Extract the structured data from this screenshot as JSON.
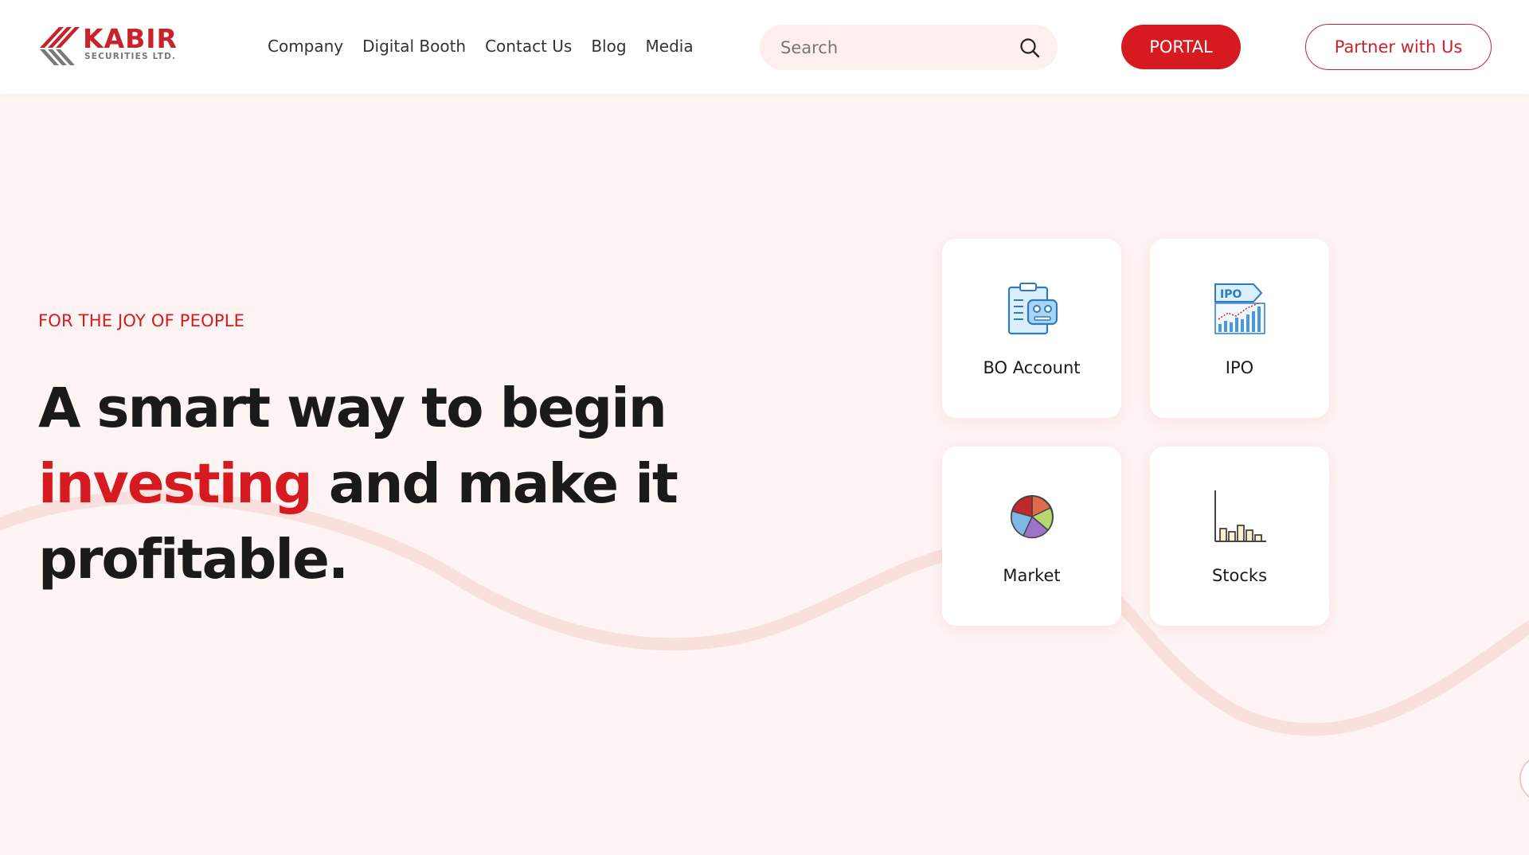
{
  "brand": {
    "name": "KABIR",
    "sub": "SECURITIES LTD.",
    "primary_color": "#d71920"
  },
  "nav": {
    "items": [
      {
        "label": "Company"
      },
      {
        "label": "Digital Booth"
      },
      {
        "label": "Contact Us"
      },
      {
        "label": "Blog"
      },
      {
        "label": "Media"
      }
    ]
  },
  "search": {
    "placeholder": "Search",
    "value": "",
    "icon": "search-icon"
  },
  "actions": {
    "portal_label": "PORTAL",
    "partner_label": "Partner with Us"
  },
  "hero": {
    "tagline": "FOR THE JOY OF PEOPLE",
    "headline_line1": "A smart way to begin",
    "headline_accent": "investing",
    "headline_rest": " and make it",
    "headline_line3": "profitable."
  },
  "services": [
    {
      "label": "BO Account",
      "icon": "bo-account-icon"
    },
    {
      "label": "IPO",
      "icon": "ipo-icon"
    },
    {
      "label": "Market",
      "icon": "pie-chart-icon"
    },
    {
      "label": "Stocks",
      "icon": "bar-chart-icon"
    }
  ]
}
